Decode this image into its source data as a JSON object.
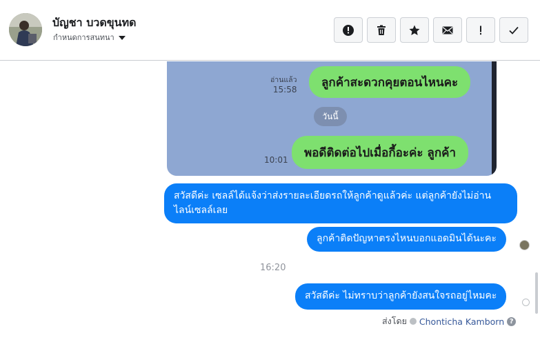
{
  "header": {
    "contact_name": "บัญชา บวดขุนทด",
    "assign_label": "กำหนดการสนทนา",
    "actions": [
      {
        "name": "report-spam-button",
        "icon": "alert-circle-icon"
      },
      {
        "name": "delete-button",
        "icon": "trash-icon"
      },
      {
        "name": "star-button",
        "icon": "star-icon"
      },
      {
        "name": "mark-unread-button",
        "icon": "envelope-icon"
      },
      {
        "name": "flag-button",
        "icon": "exclamation-icon"
      },
      {
        "name": "mark-done-button",
        "icon": "check-icon"
      }
    ]
  },
  "attachment": {
    "msg1": "ลูกค้าสะดวกคุยตอนไหนคะ",
    "msg1_read": "อ่านแล้ว",
    "msg1_time": "15:58",
    "date_label": "วันนี้",
    "msg2": "พอดีติดต่อไปเมื่อกี้อะค่ะ ลูกค้า",
    "msg2_time": "10:01"
  },
  "messages": {
    "m1": "สวัสดีค่ะ เซลล์ได้แจ้งว่าส่งรายละเอียดรถให้ลูกค้าดูแล้วค่ะ แต่ลูกค้ายังไม่อ่านไลน์เซลล์เลย",
    "m2": "ลูกค้าติดปัญหาตรงไหนบอกแอดมินได้นะคะ",
    "timestamp": "16:20",
    "m3": "สวัสดีค่ะ ไม่ทราบว่าลูกค้ายังสนใจรถอยู่ไหมคะ"
  },
  "footer": {
    "sent_by_label": "ส่งโดย",
    "sender_name": "Chonticha Kamborn"
  },
  "colors": {
    "bubble_blue": "#0b7ff8",
    "line_green": "#7ee06f",
    "line_bg": "#8ea7d2"
  }
}
